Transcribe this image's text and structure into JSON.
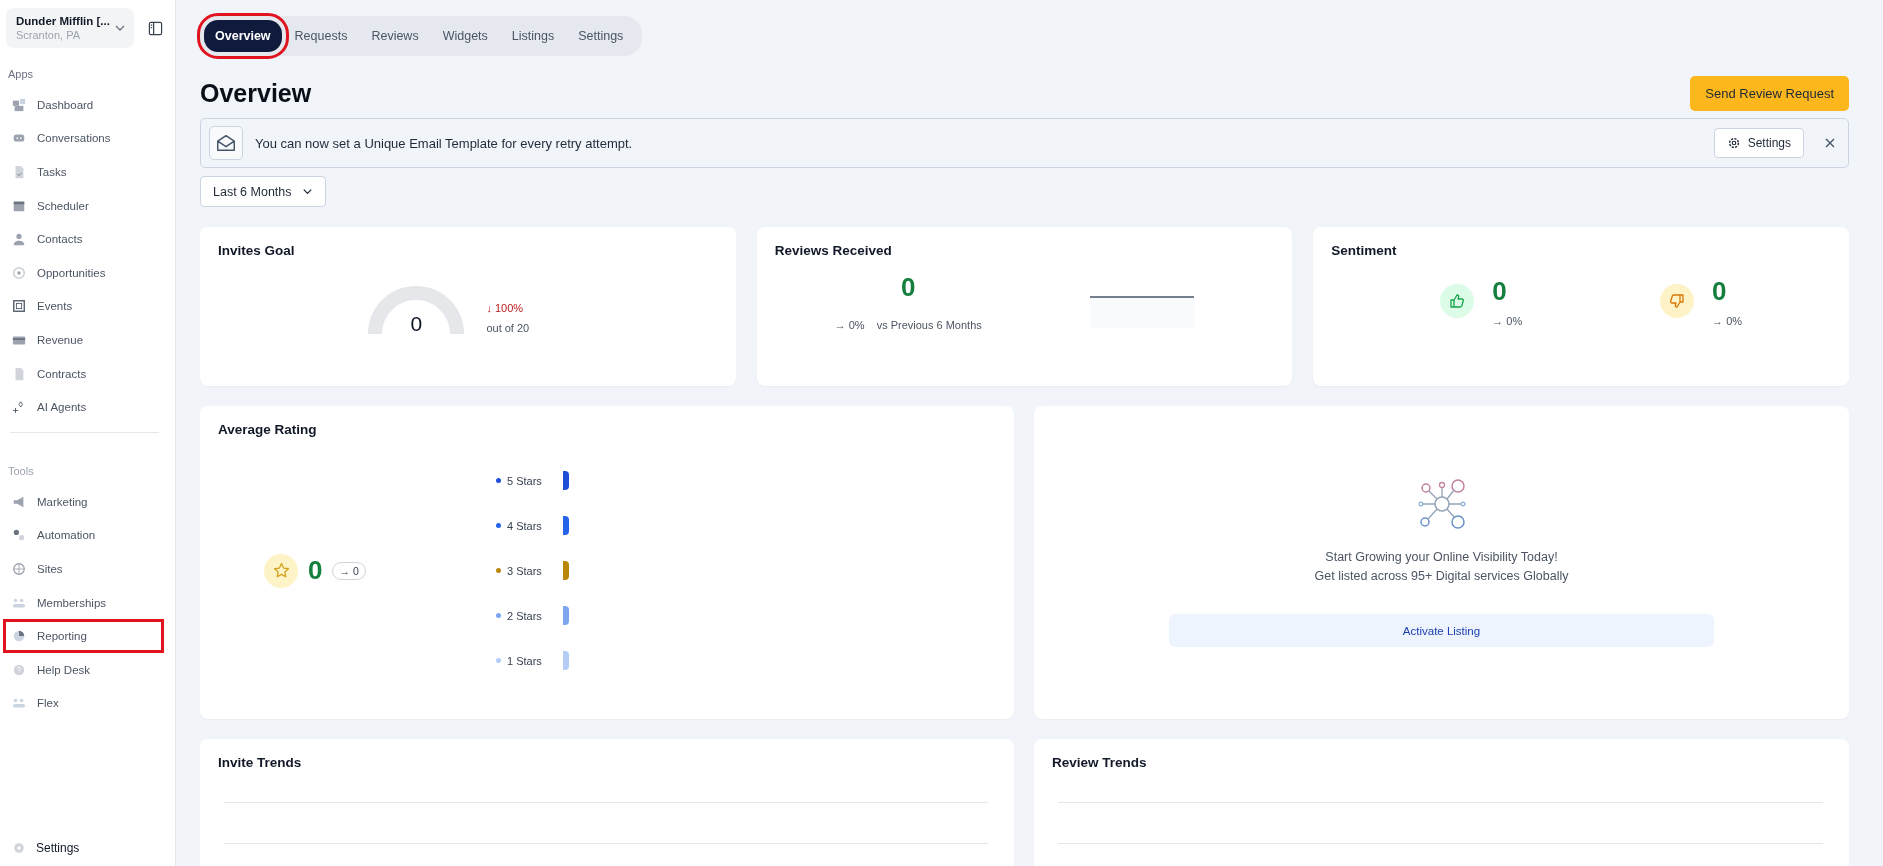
{
  "account": {
    "name": "Dunder Mifflin [...",
    "location": "Scranton, PA"
  },
  "sidebar": {
    "sections": [
      {
        "title": "Apps",
        "items": [
          {
            "label": "Dashboard",
            "highlighted": false
          },
          {
            "label": "Conversations",
            "highlighted": false
          },
          {
            "label": "Tasks",
            "highlighted": false
          },
          {
            "label": "Scheduler",
            "highlighted": false
          },
          {
            "label": "Contacts",
            "highlighted": false
          },
          {
            "label": "Opportunities",
            "highlighted": false
          },
          {
            "label": "Events",
            "highlighted": false
          },
          {
            "label": "Revenue",
            "highlighted": false
          },
          {
            "label": "Contracts",
            "highlighted": false
          },
          {
            "label": "AI Agents",
            "highlighted": false
          }
        ]
      },
      {
        "title": "Tools",
        "items": [
          {
            "label": "Marketing",
            "highlighted": false
          },
          {
            "label": "Automation",
            "highlighted": false
          },
          {
            "label": "Sites",
            "highlighted": false
          },
          {
            "label": "Memberships",
            "highlighted": false
          },
          {
            "label": "Reporting",
            "highlighted": true
          },
          {
            "label": "Help Desk",
            "highlighted": false
          },
          {
            "label": "Flex",
            "highlighted": false
          }
        ]
      }
    ],
    "footer": {
      "label": "Settings"
    }
  },
  "tabs": [
    {
      "label": "Overview",
      "selected": true,
      "highlighted": true
    },
    {
      "label": "Requests",
      "selected": false,
      "highlighted": false
    },
    {
      "label": "Reviews",
      "selected": false,
      "highlighted": false
    },
    {
      "label": "Widgets",
      "selected": false,
      "highlighted": false
    },
    {
      "label": "Listings",
      "selected": false,
      "highlighted": false
    },
    {
      "label": "Settings",
      "selected": false,
      "highlighted": false
    }
  ],
  "page_title": "Overview",
  "primary_button": "Send Review Request",
  "banner": {
    "message": "You can now set a Unique Email Template for every retry attempt.",
    "settings_button": "Settings"
  },
  "period_dropdown": {
    "value": "Last 6 Months"
  },
  "invites_goal": {
    "title": "Invites Goal",
    "value": "0",
    "change": "↓ 100%",
    "target": "out of 20"
  },
  "reviews_received": {
    "title": "Reviews Received",
    "value": "0",
    "change": "→ 0%",
    "comparison": "vs Previous 6 Months"
  },
  "sentiment": {
    "title": "Sentiment",
    "items": [
      {
        "kind": "positive",
        "value": "0",
        "change": "→ 0%"
      },
      {
        "kind": "negative",
        "value": "0",
        "change": "→ 0%"
      }
    ]
  },
  "average_rating": {
    "title": "Average Rating",
    "value": "0",
    "change": "→ 0",
    "breakdown": [
      {
        "label": "5 Stars",
        "color": "#1d4ed8"
      },
      {
        "label": "4 Stars",
        "color": "#2563eb"
      },
      {
        "label": "3 Stars",
        "color": "#b8860b"
      },
      {
        "label": "2 Stars",
        "color": "#7ea6f0"
      },
      {
        "label": "1 Stars",
        "color": "#b3cdf7"
      }
    ]
  },
  "listing_promo": {
    "headline": "Start Growing your Online Visibility Today!",
    "subline": "Get listed across 95+ Digital services Globally",
    "button": "Activate Listing"
  },
  "trends": [
    {
      "title": "Invite Trends"
    },
    {
      "title": "Review Trends"
    }
  ]
}
